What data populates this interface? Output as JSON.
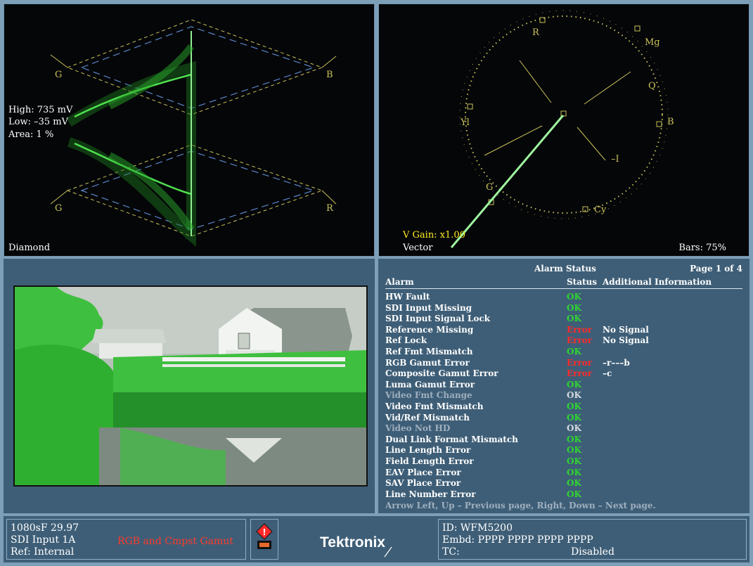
{
  "diamond": {
    "readout_high": "High: 735 mV",
    "readout_low": "Low: –35 mV",
    "readout_area": "Area:  1 %",
    "label_g_top": "G",
    "label_b": "B",
    "label_g_bottom": "G",
    "label_r": "R",
    "name": "Diamond"
  },
  "vector": {
    "gain": "V Gain: x1.00",
    "name": "Vector",
    "bars": "Bars: 75%",
    "targets": {
      "r": "R",
      "mg": "Mg",
      "q": "Q",
      "b": "B",
      "yl": "Yl",
      "i": "–I",
      "g": "G",
      "cy": "Cy"
    }
  },
  "picture": {
    "icon": "farm-barn-thumbnail"
  },
  "alarms": {
    "title": "Alarm Status",
    "page": "Page 1 of 4",
    "header": {
      "alarm": "Alarm",
      "status": "Status",
      "info": "Additional Information"
    },
    "rows": [
      {
        "name": "HW Fault",
        "status": "OK",
        "info": ""
      },
      {
        "name": "SDI Input Missing",
        "status": "OK",
        "info": ""
      },
      {
        "name": "SDI Input Signal Lock",
        "status": "OK",
        "info": ""
      },
      {
        "name": "Reference Missing",
        "status": "Error",
        "info": "No Signal"
      },
      {
        "name": "Ref Lock",
        "status": "Error",
        "info": "No Signal"
      },
      {
        "name": "Ref Fmt Mismatch",
        "status": "OK",
        "info": ""
      },
      {
        "name": "RGB Gamut Error",
        "status": "Error",
        "info": "–r–––b"
      },
      {
        "name": "Composite Gamut Error",
        "status": "Error",
        "info": "–c"
      },
      {
        "name": "Luma Gamut Error",
        "status": "OK",
        "info": ""
      },
      {
        "name": "Video Fmt Change",
        "status": "OK",
        "info": ""
      },
      {
        "name": "Video Fmt Mismatch",
        "status": "OK",
        "info": ""
      },
      {
        "name": "Vid/Ref Mismatch",
        "status": "OK",
        "info": ""
      },
      {
        "name": "Video Not HD",
        "status": "OK",
        "info": ""
      },
      {
        "name": "Dual Link Format Mismatch",
        "status": "OK",
        "info": ""
      },
      {
        "name": "Line Length Error",
        "status": "OK",
        "info": ""
      },
      {
        "name": "Field Length Error",
        "status": "OK",
        "info": ""
      },
      {
        "name": "EAV Place Error",
        "status": "OK",
        "info": ""
      },
      {
        "name": "SAV Place Error",
        "status": "OK",
        "info": ""
      },
      {
        "name": "Line Number Error",
        "status": "OK",
        "info": ""
      }
    ],
    "footer": "Arrow Left, Up – Previous page, Right, Down – Next page."
  },
  "statusbar": {
    "format": "1080sF 29.97",
    "input": "SDI Input 1A",
    "ref": "Ref: Internal",
    "warning": "RGB and Cmpst Gamut",
    "brand": "Tektronix",
    "id": "ID: WFM5200",
    "embd": "Embd: PPPP PPPP PPPP PPPP",
    "tc_label": "TC:",
    "tc_value": "Disabled"
  },
  "colors": {
    "panel_bg": "#3e5e77",
    "border": "#7d9fb8",
    "ok": "#2fd72f",
    "error": "#ff2a2a",
    "graticule": "#c9c25a",
    "trace": "#4fe04f"
  }
}
